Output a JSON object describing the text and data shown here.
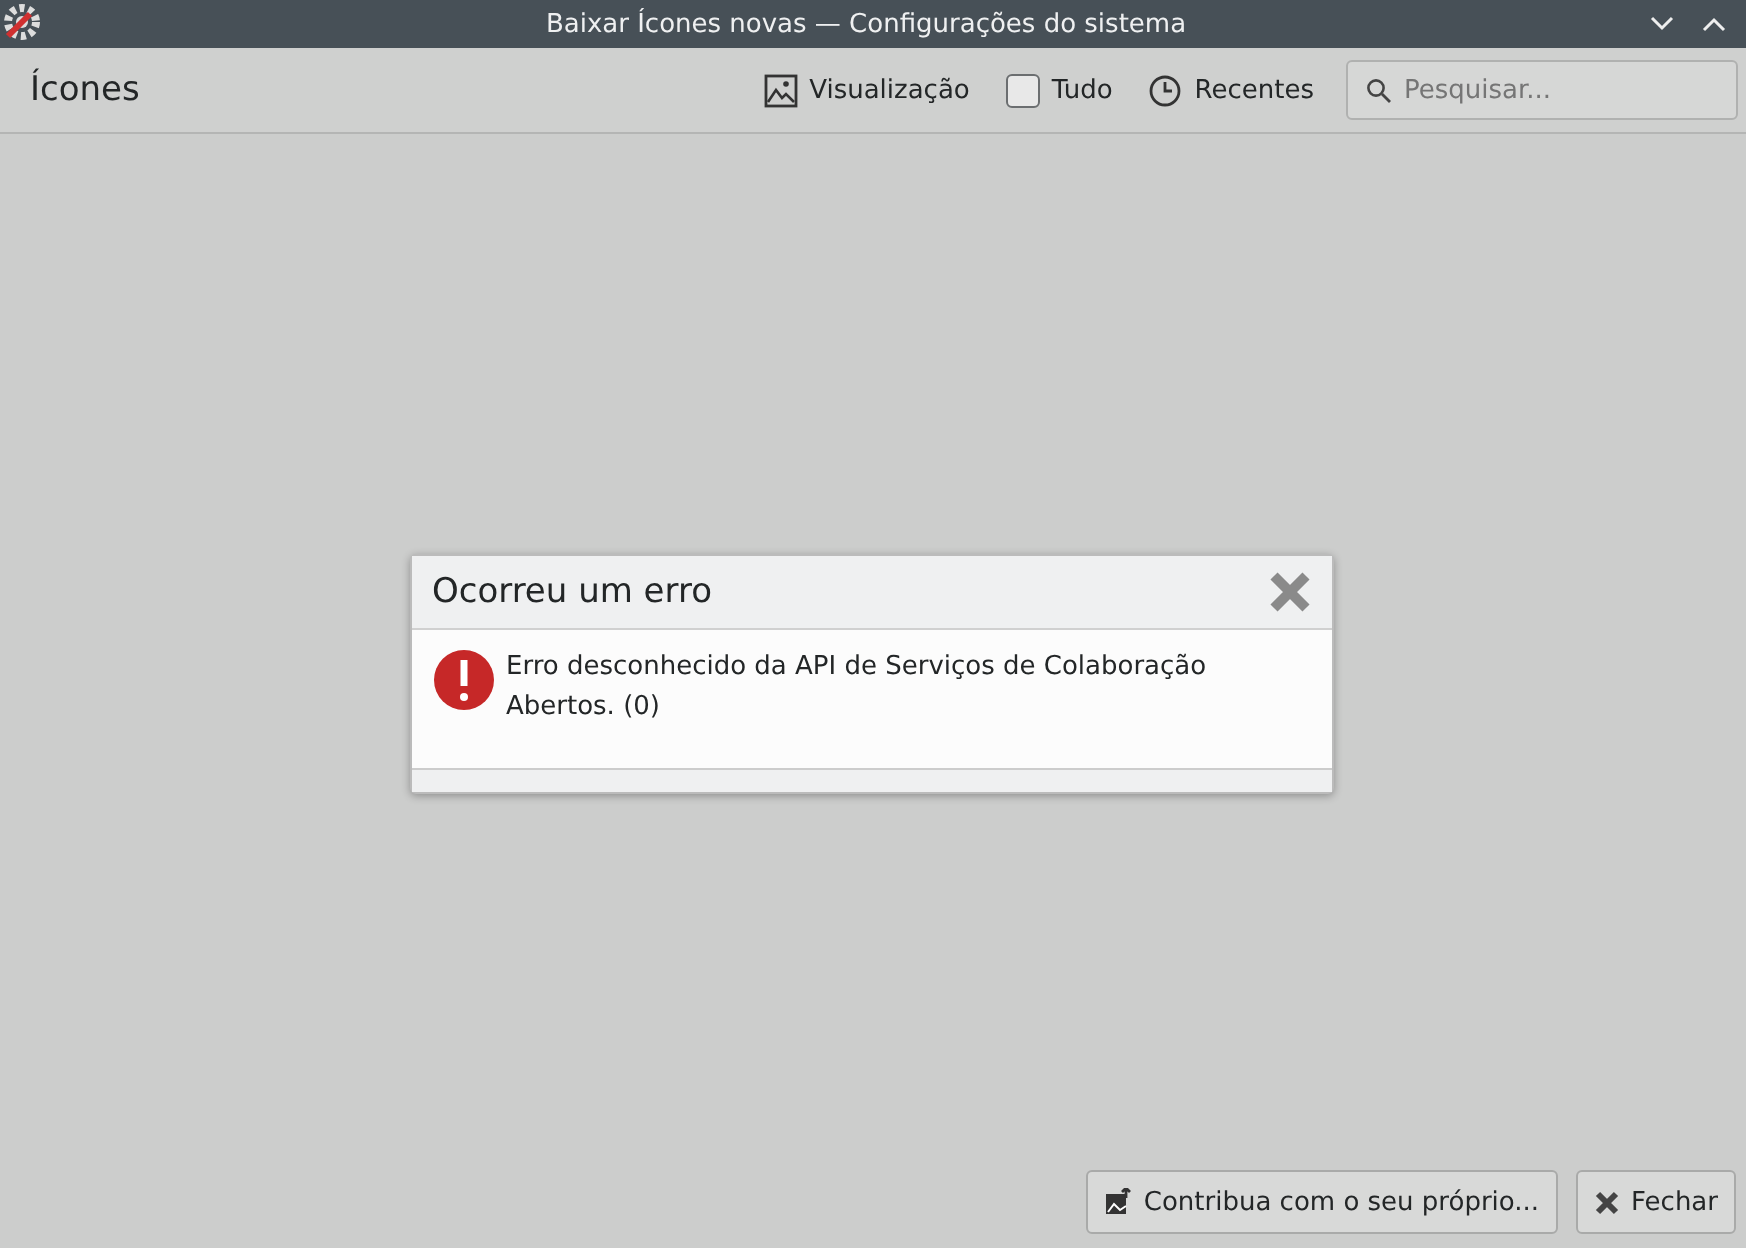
{
  "window": {
    "title": "Baixar Ícones novas — Configurações do sistema"
  },
  "toolbar": {
    "heading": "Ícones",
    "view_button": "Visualização",
    "all_checkbox": {
      "label": "Tudo",
      "checked": false
    },
    "recent_button": "Recentes",
    "search": {
      "placeholder": "Pesquisar..."
    }
  },
  "dialog": {
    "title": "Ocorreu um erro",
    "message": "Erro desconhecido da API de Serviços de Colaboração Abertos. (0)"
  },
  "buttons": [
    {
      "kind": "contribute",
      "label": "Contribua com o seu próprio..."
    },
    {
      "kind": "close",
      "label": "Fechar"
    }
  ]
}
